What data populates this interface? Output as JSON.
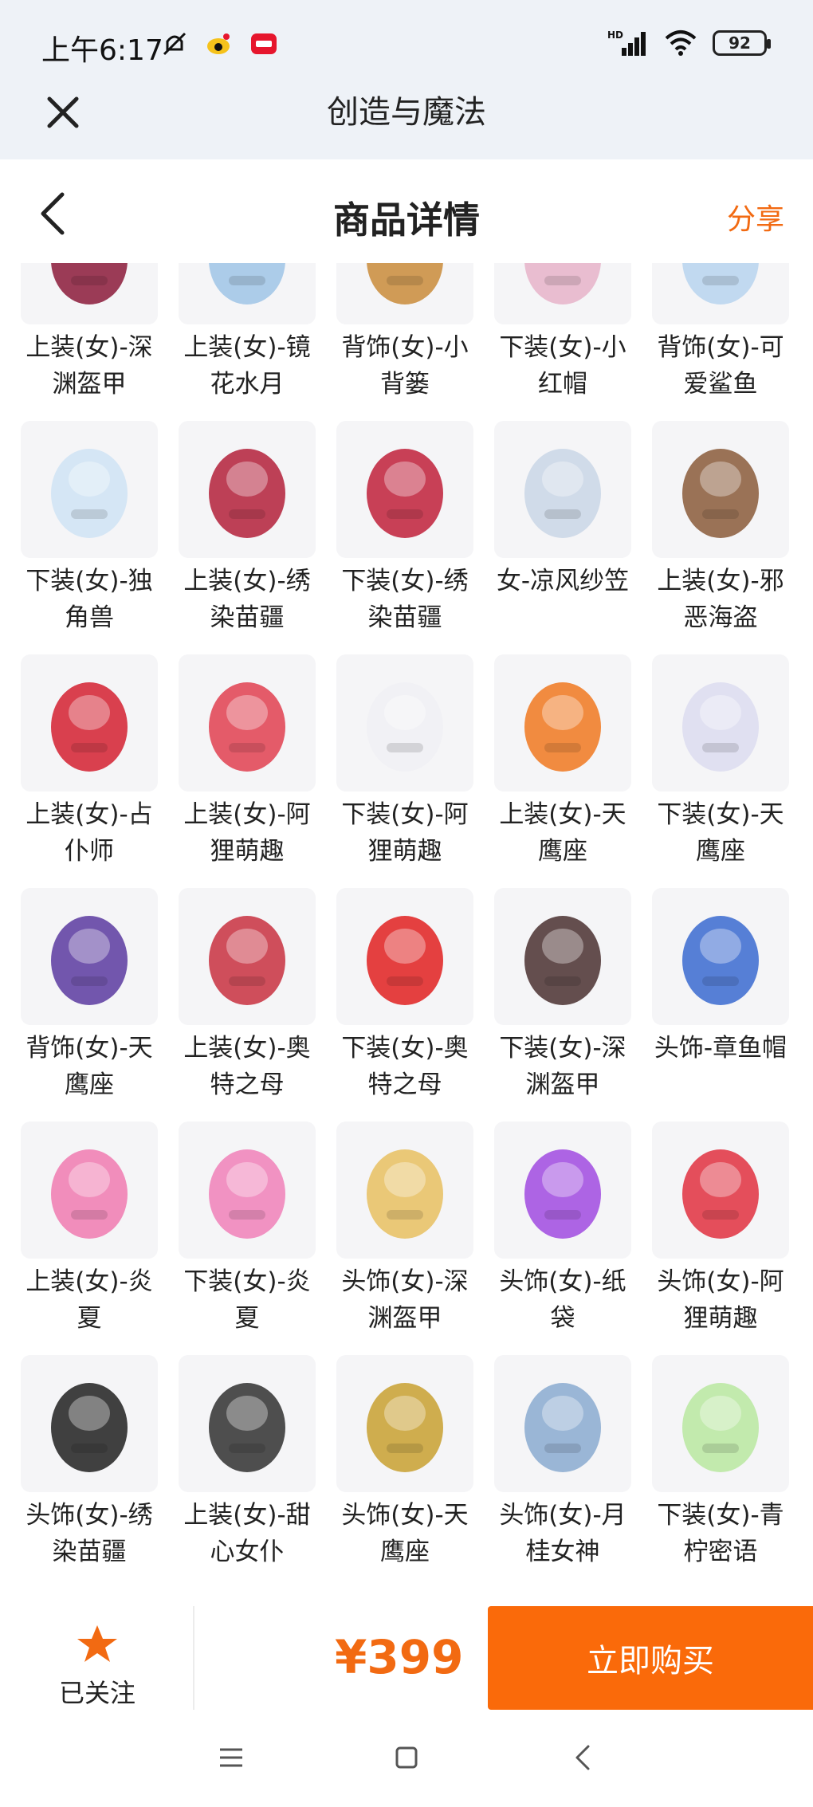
{
  "status": {
    "time": "上午6:17",
    "battery": "92",
    "network_badge": "HD",
    "icons": [
      "mute-icon",
      "weibo-icon",
      "app-badge-icon",
      "signal-icon",
      "wifi-icon",
      "battery-icon"
    ]
  },
  "app": {
    "title": "创造与魔法"
  },
  "header": {
    "title": "商品详情",
    "share_label": "分享"
  },
  "colors": {
    "accent": "#f26a12",
    "buy_button": "#fa6a0a",
    "thumb_bg": "#f5f5f7",
    "top_bg": "#eef2f7"
  },
  "items": [
    {
      "label": "上装(女)-深渊盔甲",
      "icon": "armor-top-icon",
      "color": "#8b1a3a"
    },
    {
      "label": "上装(女)-镜花水月",
      "icon": "dress-top-icon",
      "color": "#9fc4e6"
    },
    {
      "label": "背饰(女)-小背篓",
      "icon": "basket-icon",
      "color": "#c98b3a"
    },
    {
      "label": "下装(女)-小红帽",
      "icon": "boots-icon",
      "color": "#e6b3c9"
    },
    {
      "label": "背饰(女)-可爱鲨鱼",
      "icon": "shark-icon",
      "color": "#b7d3ef"
    },
    {
      "label": "下装(女)-独角兽",
      "icon": "unicorn-shoes-icon",
      "color": "#cfe3f5"
    },
    {
      "label": "上装(女)-绣染苗疆",
      "icon": "embroidered-top-icon",
      "color": "#b3203a"
    },
    {
      "label": "下装(女)-绣染苗疆",
      "icon": "embroidered-skirt-icon",
      "color": "#c0203a"
    },
    {
      "label": "女-凉风纱笠",
      "icon": "veil-hat-icon",
      "color": "#c9d6e6"
    },
    {
      "label": "上装(女)-邪恶海盗",
      "icon": "pirate-top-icon",
      "color": "#8a5a3a"
    },
    {
      "label": "上装(女)-占仆师",
      "icon": "red-dress-icon",
      "color": "#d42030"
    },
    {
      "label": "上装(女)-阿狸萌趣",
      "icon": "white-jacket-icon",
      "color": "#e04050"
    },
    {
      "label": "下装(女)-阿狸萌趣",
      "icon": "white-boots-icon",
      "color": "#f0f0f5"
    },
    {
      "label": "上装(女)-天鹰座",
      "icon": "orange-jacket-icon",
      "color": "#f07820"
    },
    {
      "label": "下装(女)-天鹰座",
      "icon": "white-pants-icon",
      "color": "#dcdcf0"
    },
    {
      "label": "背饰(女)-天鹰座",
      "icon": "robot-backpack-icon",
      "color": "#5a3aa0"
    },
    {
      "label": "上装(女)-奥特之母",
      "icon": "silver-top-icon",
      "color": "#c83040"
    },
    {
      "label": "下装(女)-奥特之母",
      "icon": "red-boots-icon",
      "color": "#e02020"
    },
    {
      "label": "下装(女)-深渊盔甲",
      "icon": "dark-stockings-icon",
      "color": "#4a3030"
    },
    {
      "label": "头饰-章鱼帽",
      "icon": "octopus-hat-icon",
      "color": "#3a6ad0"
    },
    {
      "label": "上装(女)-炎夏",
      "icon": "pink-bikini-icon",
      "color": "#f07ab0"
    },
    {
      "label": "下装(女)-炎夏",
      "icon": "pink-skirt-icon",
      "color": "#f080b8"
    },
    {
      "label": "头饰(女)-深渊盔甲",
      "icon": "blonde-hair-icon",
      "color": "#e8c060"
    },
    {
      "label": "头饰(女)-纸袋",
      "icon": "paper-bag-icon",
      "color": "#a04ae0"
    },
    {
      "label": "头饰(女)-阿狸萌趣",
      "icon": "headphones-icon",
      "color": "#e03040"
    },
    {
      "label": "头饰(女)-绣染苗疆",
      "icon": "black-hair-icon",
      "color": "#202020"
    },
    {
      "label": "上装(女)-甜心女仆",
      "icon": "maid-dress-icon",
      "color": "#303030"
    },
    {
      "label": "头饰(女)-天鹰座",
      "icon": "gold-helmet-icon",
      "color": "#c8a030"
    },
    {
      "label": "头饰(女)-月桂女神",
      "icon": "blue-hair-icon",
      "color": "#8aaad0"
    },
    {
      "label": "下装(女)-青柠密语",
      "icon": "lime-boots-icon",
      "color": "#b8e8a0"
    }
  ],
  "bottom": {
    "follow_label": "已关注",
    "price": "¥399",
    "buy_label": "立即购买"
  },
  "nav": {
    "buttons": [
      "menu-icon",
      "home-icon",
      "back-icon"
    ]
  }
}
